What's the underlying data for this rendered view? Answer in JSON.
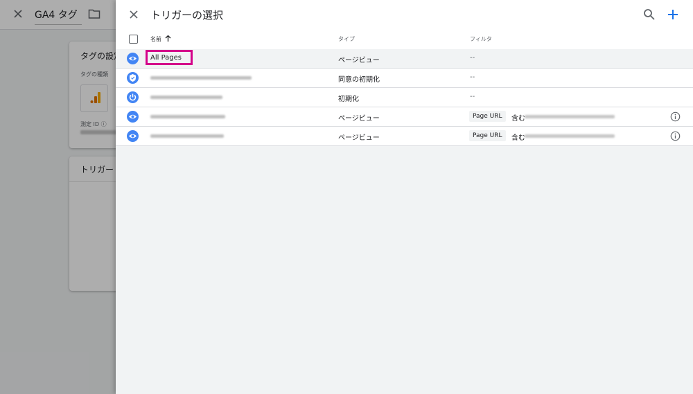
{
  "background": {
    "title": "GA4 タグ",
    "card1": {
      "title": "タグの設定",
      "type_label": "タグの種類",
      "measure_label": "測定 ID"
    },
    "card2": {
      "title": "トリガー"
    }
  },
  "panel": {
    "title": "トリガーの選択",
    "columns": {
      "name": "名前",
      "type": "タイプ",
      "filter": "フィルタ"
    },
    "rows": [
      {
        "name": "All Pages",
        "type": "ページビュー",
        "filter": "--",
        "icon": "eye-icon",
        "name_visible": true,
        "selected": true
      },
      {
        "name": "",
        "type": "同意の初期化",
        "filter": "--",
        "icon": "shield-icon",
        "name_visible": false
      },
      {
        "name": "",
        "type": "初期化",
        "filter": "--",
        "icon": "power-icon",
        "name_visible": false
      },
      {
        "name": "",
        "type": "ページビュー",
        "filter_variable": "Page URL",
        "filter_operator": "含む",
        "icon": "eye-icon",
        "name_visible": false,
        "has_info": true
      },
      {
        "name": "",
        "type": "ページビュー",
        "filter_variable": "Page URL",
        "filter_operator": "含む",
        "icon": "eye-icon",
        "name_visible": false,
        "has_info": true
      }
    ]
  },
  "colors": {
    "accent": "#4285f4",
    "highlight": "#d4008a",
    "text": "#202124",
    "muted": "#5f6368"
  }
}
